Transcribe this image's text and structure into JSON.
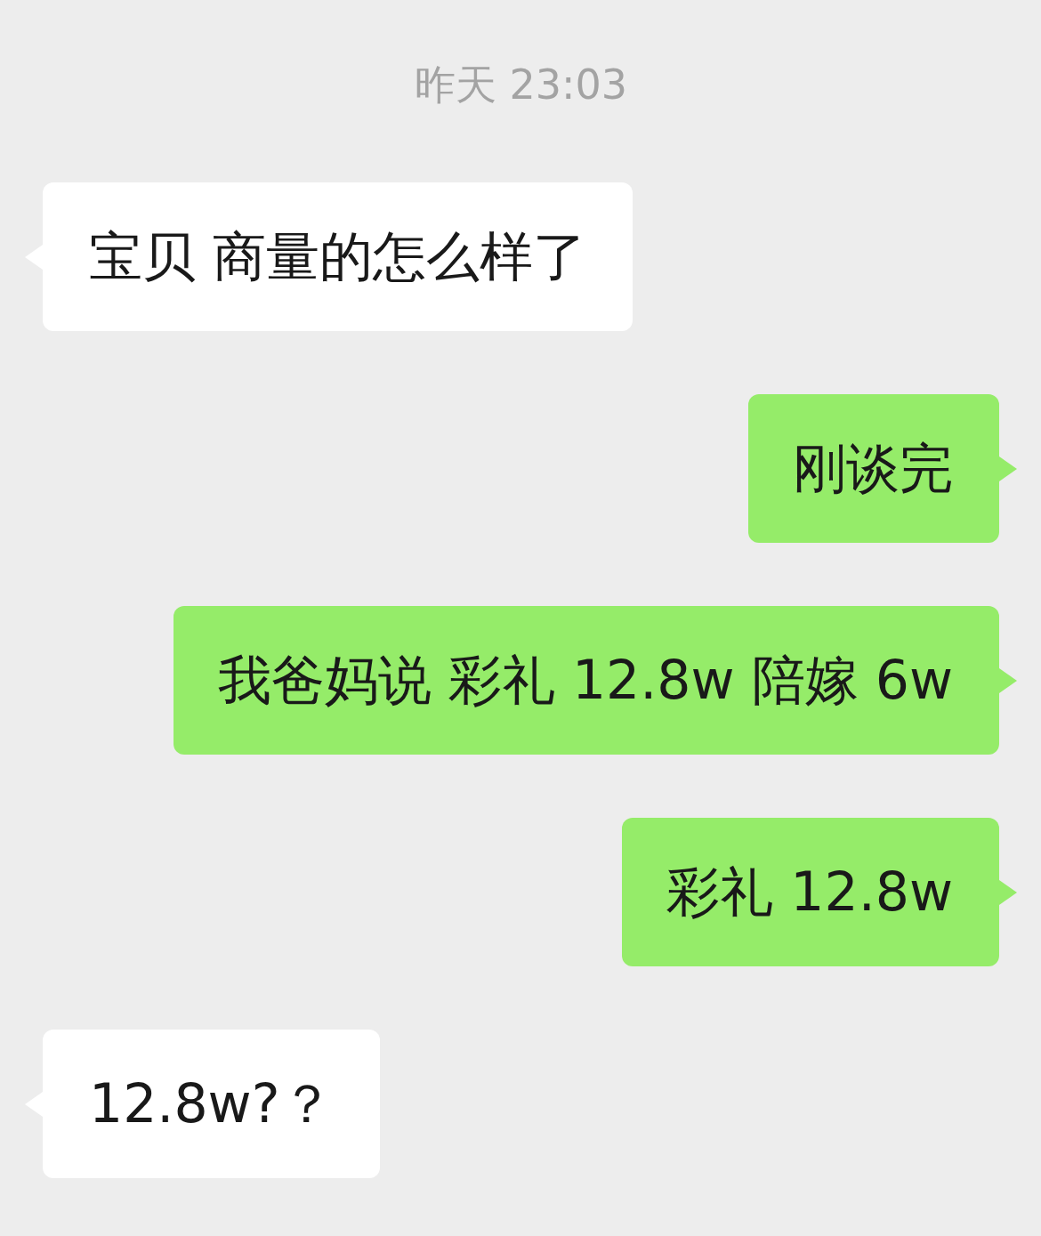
{
  "timestamp": "昨天 23:03",
  "messages": [
    {
      "kind": "received",
      "text": "宝贝 商量的怎么样了"
    },
    {
      "kind": "sent",
      "text": "刚谈完"
    },
    {
      "kind": "sent",
      "text": "我爸妈说 彩礼 12.8w 陪嫁 6w"
    },
    {
      "kind": "sent",
      "text": "彩礼 12.8w"
    },
    {
      "kind": "received",
      "text": "12.8w?？"
    }
  ]
}
